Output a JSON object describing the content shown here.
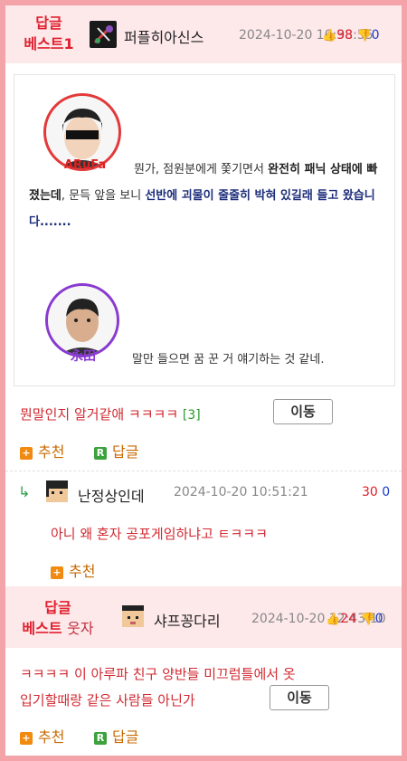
{
  "post1": {
    "badge_line1": "답글",
    "badge_line2": "베스트1",
    "nickname": "퍼플히아신스",
    "timestamp": "2024-10-20 10:38:55",
    "up": "98",
    "down": "0",
    "image": {
      "char1_tag": "ARuFa",
      "char2_tag": "永田",
      "quote_parts": [
        "뭔가, 점원분에게 쫓기면서 ",
        "완전히 패닉 상태에 빠졌는데",
        ", 문득 앞을 보니 ",
        "선반에 괴물이 줄줄히 박혀 있길래 들고 왔습니다......."
      ],
      "reply_caption": "말만 들으면 꿈 꾼 거 얘기하는 것 같네."
    },
    "comment": "뭔말인지 알거같애 ㅋㅋㅋㅋ",
    "comment_count": "[3]",
    "move_label": "이동",
    "recommend_label": "추천",
    "reply_label": "답글"
  },
  "reply1": {
    "nickname": "난정상인데",
    "timestamp": "2024-10-20 10:51:21",
    "up": "30",
    "down": "0",
    "comment": "아니 왜 혼자 공포게임하냐고 ㅌㅋㅋㅋ",
    "recommend_label": "추천"
  },
  "post2": {
    "badge_line1": "답글",
    "badge_line2a": "베스트",
    "badge_line2b": "웃자",
    "nickname": "샤프꽁다리",
    "timestamp": "2024-10-20 12:43:10",
    "up": "24",
    "down": "0",
    "comment_line1": "ㅋㅋㅋㅋ 이 아루파 친구 양반들 미끄럼틀에서 옷",
    "comment_line2": "입기할때랑 같은 사람들 아닌가",
    "move_label": "이동",
    "recommend_label": "추천",
    "reply_label": "답글"
  },
  "colors": {
    "accent_red": "#e0202e",
    "accent_blue": "#1a3cc8",
    "border_pink": "#f4a4a8",
    "header_pink": "#fde8ea"
  }
}
